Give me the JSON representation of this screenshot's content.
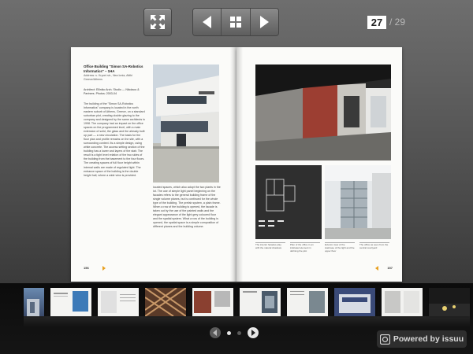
{
  "toolbar": {
    "fullscreen_icon": "expand-arrows-icon",
    "prev_icon": "triangle-left-icon",
    "grid_icon": "grid-four-icon",
    "next_icon": "triangle-right-icon",
    "current_page": "27",
    "total_pages": "/ 29"
  },
  "spread": {
    "left": {
      "title": "Office Building \"Simon SA-Robotics Informatics\" – 1HA",
      "meta": "Address: s. Kryoni str., Nea Ionia, Attiki Greece/Athens",
      "credit": "Architect: Elliniko Arch. Studio — Nikolaou & Partners. Photos: 2003-04",
      "col1": "The building of the \"Simon SA-Robotics Informatics\" company is located in the north eastern suburb of Athens, Greece, on a standard suburban plot, creating double glazing to the company and designed by the same architects in 1998. The company had an impact on the office spaces on the programmed level, with a main extension of solid, the glass and the already built up part — a new circulation. The basis for the floor plan and profile remains on the site, with a surrounding context. Its a simple design, using white concrete. The access setting section of the building has a lower and layers of the stair. The result is a tight level relation of the two sides of the building from the basement to the four floors. The creating spaces of full floor height within internal walls are made of regulated light. The entrance space of the building is the double height hall, where a wide view is provided.",
      "col2": "located spaces, which also adopt the two plants in the lot. The use of simple light panel beginning on the facades refers to the general building frame of the single volume planes, but is continued for the whole type of the building. The prefab system, a plain frame. When a row of the building is opened, the facade is taken out by the use of the painted walls and the elegant appearance of the light grey coloured floor and the spatial system. What a row of the building is opened, the spatial space is a simple composition of different planes and the building volume.",
      "folio": "156"
    },
    "right": {
      "captions": [
        "The interior facades play with the natural shadows",
        "Plan of the office in an indicated element in defining the plot",
        "Exterior view of the staircase of the light and the upper floor",
        "The office as seen from the central courtyard"
      ],
      "folio": "157"
    }
  },
  "thumbnails_count": 10,
  "pager": {
    "prev_icon": "circle-arrow-left-icon",
    "next_icon": "circle-arrow-right-icon",
    "active_dot": 0
  },
  "branding": {
    "label": "Powered by issuu",
    "logo_icon": "issuu-logo-icon"
  }
}
